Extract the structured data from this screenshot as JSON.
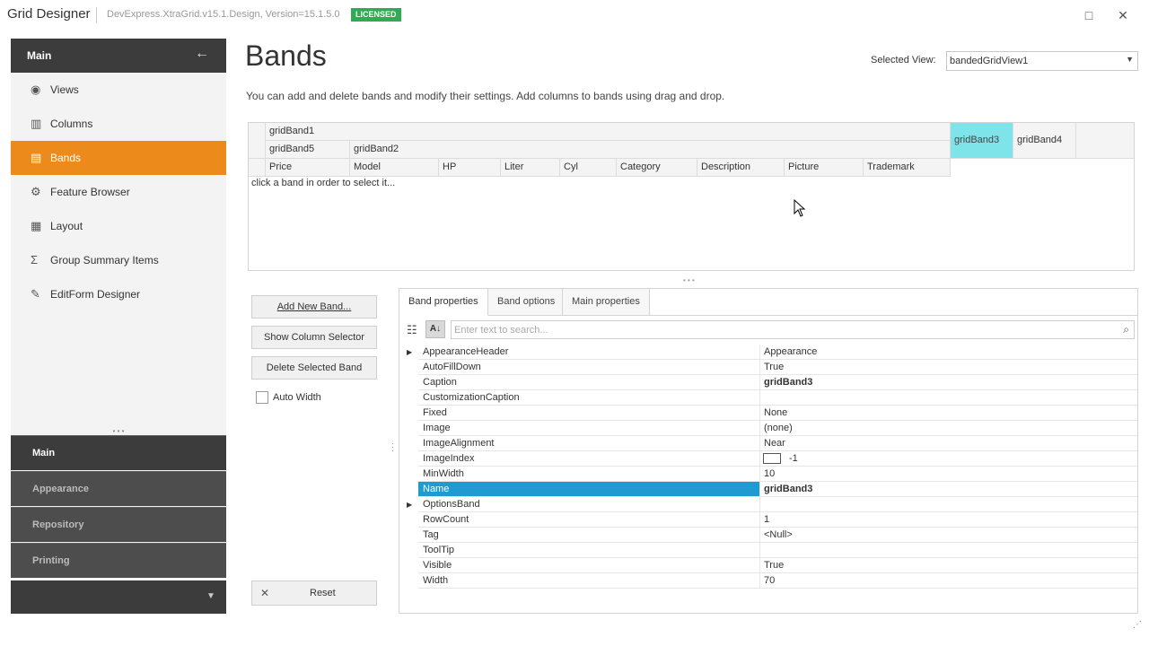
{
  "window": {
    "title": "Grid Designer",
    "subtitle": "DevExpress.XtraGrid.v15.1.Design, Version=15.1.5.0",
    "badge": "LICENSED",
    "badge_color": "#2eab53",
    "accent": "#ec8a1c"
  },
  "sidebar": {
    "header": "Main",
    "items": [
      {
        "label": "Views",
        "icon": "eye-icon"
      },
      {
        "label": "Columns",
        "icon": "columns-icon"
      },
      {
        "label": "Bands",
        "icon": "bands-icon",
        "active": true
      },
      {
        "label": "Feature Browser",
        "icon": "gear-icon"
      },
      {
        "label": "Layout",
        "icon": "layout-icon"
      },
      {
        "label": "Group Summary Items",
        "icon": "sigma-icon"
      },
      {
        "label": "EditForm Designer",
        "icon": "edit-form-icon"
      }
    ],
    "groups": [
      "Main",
      "Appearance",
      "Repository",
      "Printing"
    ]
  },
  "main": {
    "title": "Bands",
    "selected_view_label": "Selected View:",
    "selected_view_value": "bandedGridView1",
    "description": "You can add and delete bands and modify their settings. Add columns to bands using drag and drop.",
    "grid": {
      "band_top": "gridBand1",
      "band_sub1": "gridBand5",
      "band_sub2": "gridBand2",
      "band3": "gridBand3",
      "band4": "gridBand4",
      "columns": [
        "Price",
        "Model",
        "HP",
        "Liter",
        "Cyl",
        "Category",
        "Description",
        "Picture",
        "Trademark"
      ],
      "hint": "click a band in order to select it..."
    },
    "buttons": {
      "add": "Add New Band...",
      "show_selector": "Show Column Selector",
      "delete": "Delete Selected Band",
      "auto_width": "Auto Width",
      "reset": "Reset"
    }
  },
  "props": {
    "tabs": [
      "Band properties",
      "Band options",
      "Main properties"
    ],
    "search_placeholder": "Enter text to search...",
    "rows": [
      {
        "name": "AppearanceHeader",
        "value": "Appearance",
        "expandable": true
      },
      {
        "name": "AutoFillDown",
        "value": "True"
      },
      {
        "name": "Caption",
        "value": "gridBand3",
        "bold": true
      },
      {
        "name": "CustomizationCaption",
        "value": ""
      },
      {
        "name": "Fixed",
        "value": "None"
      },
      {
        "name": "Image",
        "value": "(none)"
      },
      {
        "name": "ImageAlignment",
        "value": "Near"
      },
      {
        "name": "ImageIndex",
        "value": "-1",
        "swatch": true
      },
      {
        "name": "MinWidth",
        "value": "10"
      },
      {
        "name": "Name",
        "value": "gridBand3",
        "bold": true,
        "selected": true
      },
      {
        "name": "OptionsBand",
        "value": "",
        "expandable": true
      },
      {
        "name": "RowCount",
        "value": "1"
      },
      {
        "name": "Tag",
        "value": "<Null>"
      },
      {
        "name": "ToolTip",
        "value": ""
      },
      {
        "name": "Visible",
        "value": "True"
      },
      {
        "name": "Width",
        "value": "70"
      }
    ]
  }
}
